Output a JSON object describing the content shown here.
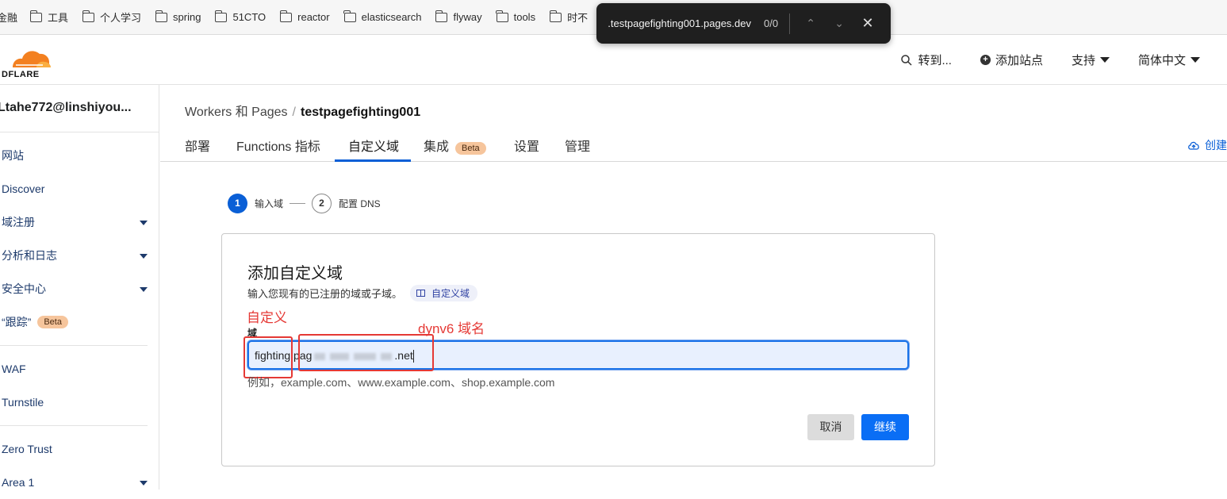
{
  "bookmarks": {
    "items": [
      "金融",
      "工具",
      "个人学习",
      "spring",
      "51CTO",
      "reactor",
      "elasticsearch",
      "flyway",
      "tools",
      "时不"
    ]
  },
  "findbar": {
    "query": "testpagefighting001.pages.dev.",
    "count": "0/0",
    "prev_icon": "chevron-up-icon",
    "next_icon": "chevron-down-icon",
    "close_icon": "close-icon"
  },
  "header": {
    "logo_text": "DFLARE",
    "goto_label": "转到...",
    "add_site_label": "添加站点",
    "support_label": "支持",
    "language_label": "简体中文"
  },
  "sidebar": {
    "account": "Ltahe772@linshiyou...",
    "items": [
      {
        "label": "网站",
        "dropdown": false
      },
      {
        "label": "Discover",
        "dropdown": false
      },
      {
        "label": "域注册",
        "dropdown": true
      },
      {
        "label": "分析和日志",
        "dropdown": true
      },
      {
        "label": "安全中心",
        "dropdown": true
      },
      {
        "label": "“跟踪”",
        "badge": "Beta"
      },
      {
        "label": "WAF"
      },
      {
        "label": "Turnstile"
      },
      {
        "label": "Zero Trust"
      },
      {
        "label": "Area 1",
        "dropdown": true
      }
    ]
  },
  "breadcrumb": {
    "parent": "Workers 和 Pages",
    "separator": "/",
    "current": "testpagefighting001"
  },
  "tabs": {
    "items": [
      "部署",
      "Functions 指标",
      "自定义域",
      "集成",
      "设置",
      "管理"
    ],
    "beta_badge": "Beta",
    "active": "自定义域",
    "create_label": "创建"
  },
  "stepper": {
    "step1_num": "1",
    "step1_label": "输入域",
    "step2_num": "2",
    "step2_label": "配置 DNS"
  },
  "card": {
    "title": "添加自定义域",
    "description": "输入您现有的已注册的域或子域。",
    "doc_link": "自定义域",
    "annotation_custom": "自定义",
    "field_label": "域",
    "annotation_dynv6": "dynv6 域名",
    "input_prefix": "fighting.pag",
    "input_suffix": ".net",
    "hint": "例如，example.com、www.example.com、shop.example.com",
    "cancel_label": "取消",
    "continue_label": "继续"
  },
  "colors": {
    "accent": "#0a5fd6",
    "primary_button": "#0a6ef5",
    "annotation": "#e53935",
    "beta_badge": "#f6c59c",
    "logo_orange": "#f38020"
  }
}
